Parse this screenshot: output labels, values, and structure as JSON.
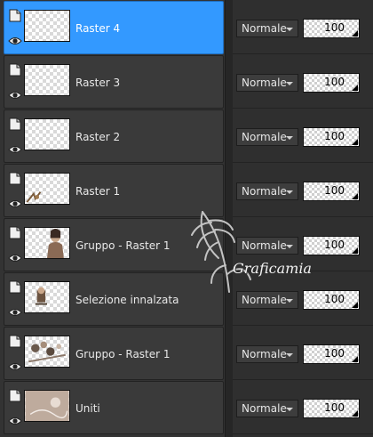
{
  "layers_panel": {
    "layers": [
      {
        "name": "Raster 4",
        "blend_mode": "Normale",
        "opacity": "100",
        "selected": true,
        "thumb": "empty"
      },
      {
        "name": "Raster 3",
        "blend_mode": "Normale",
        "opacity": "100",
        "selected": false,
        "thumb": "empty"
      },
      {
        "name": "Raster 2",
        "blend_mode": "Normale",
        "opacity": "100",
        "selected": false,
        "thumb": "empty"
      },
      {
        "name": "Raster 1",
        "blend_mode": "Normale",
        "opacity": "100",
        "selected": false,
        "thumb": "corner-deco"
      },
      {
        "name": "Gruppo - Raster 1",
        "blend_mode": "Normale",
        "opacity": "100",
        "selected": false,
        "thumb": "figure"
      },
      {
        "name": "Selezione innalzata",
        "blend_mode": "Normale",
        "opacity": "100",
        "selected": false,
        "thumb": "small-figure"
      },
      {
        "name": "Gruppo - Raster 1",
        "blend_mode": "Normale",
        "opacity": "100",
        "selected": false,
        "thumb": "flowers"
      },
      {
        "name": "Uniti",
        "blend_mode": "Normale",
        "opacity": "100",
        "selected": false,
        "thumb": "merged"
      }
    ]
  },
  "watermark": {
    "text": "Graficamia"
  },
  "colors": {
    "selected": "#3399ff",
    "row": "#3a3a3a",
    "background": "#2b2b2b"
  }
}
